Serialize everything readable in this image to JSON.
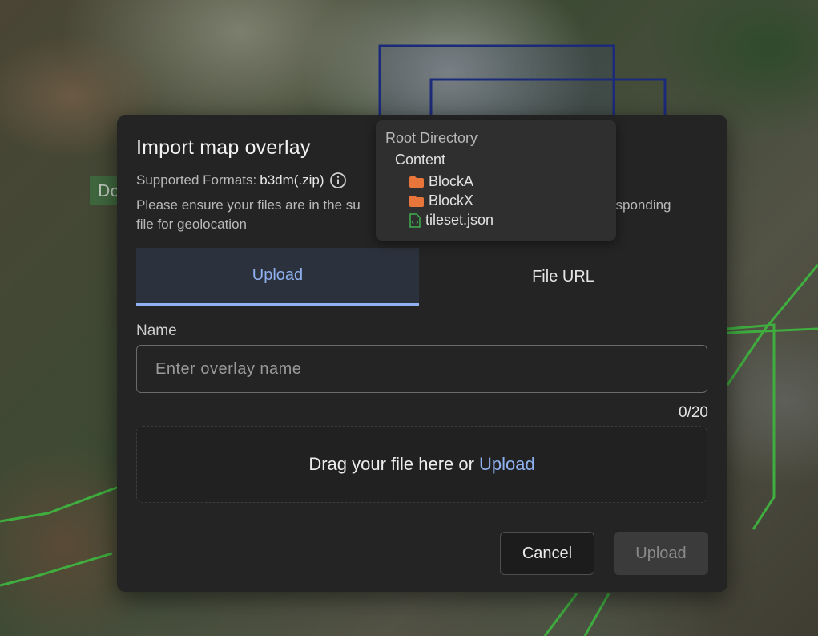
{
  "map": {
    "label_fragment": "Do"
  },
  "dialog": {
    "title": "Import map overlay",
    "formats_label": "Supported Formats:",
    "formats_value": "b3dm(.zip)",
    "instructions": "Please ensure your files are in the su",
    "instructions_tail": "rresponding",
    "instructions_line2": "file for geolocation",
    "tabs": [
      {
        "label": "Upload",
        "active": true
      },
      {
        "label": "File URL",
        "active": false
      }
    ],
    "name_label": "Name",
    "name_placeholder": "Enter overlay name",
    "name_value": "",
    "counter": "0/20",
    "dropzone_text": "Drag your file here or",
    "dropzone_link": "Upload",
    "cancel_label": "Cancel",
    "upload_label": "Upload"
  },
  "tooltip": {
    "root": "Root Directory",
    "content": "Content",
    "items": [
      "BlockA",
      "BlockX",
      "tileset.json"
    ]
  },
  "icons": {
    "info": "info-icon",
    "folder": "folder-icon",
    "file": "file-code-icon"
  },
  "colors": {
    "accent": "#8fb1ef",
    "folder": "#e8763a",
    "file": "#3fae4f",
    "dialog_bg": "#242424"
  }
}
